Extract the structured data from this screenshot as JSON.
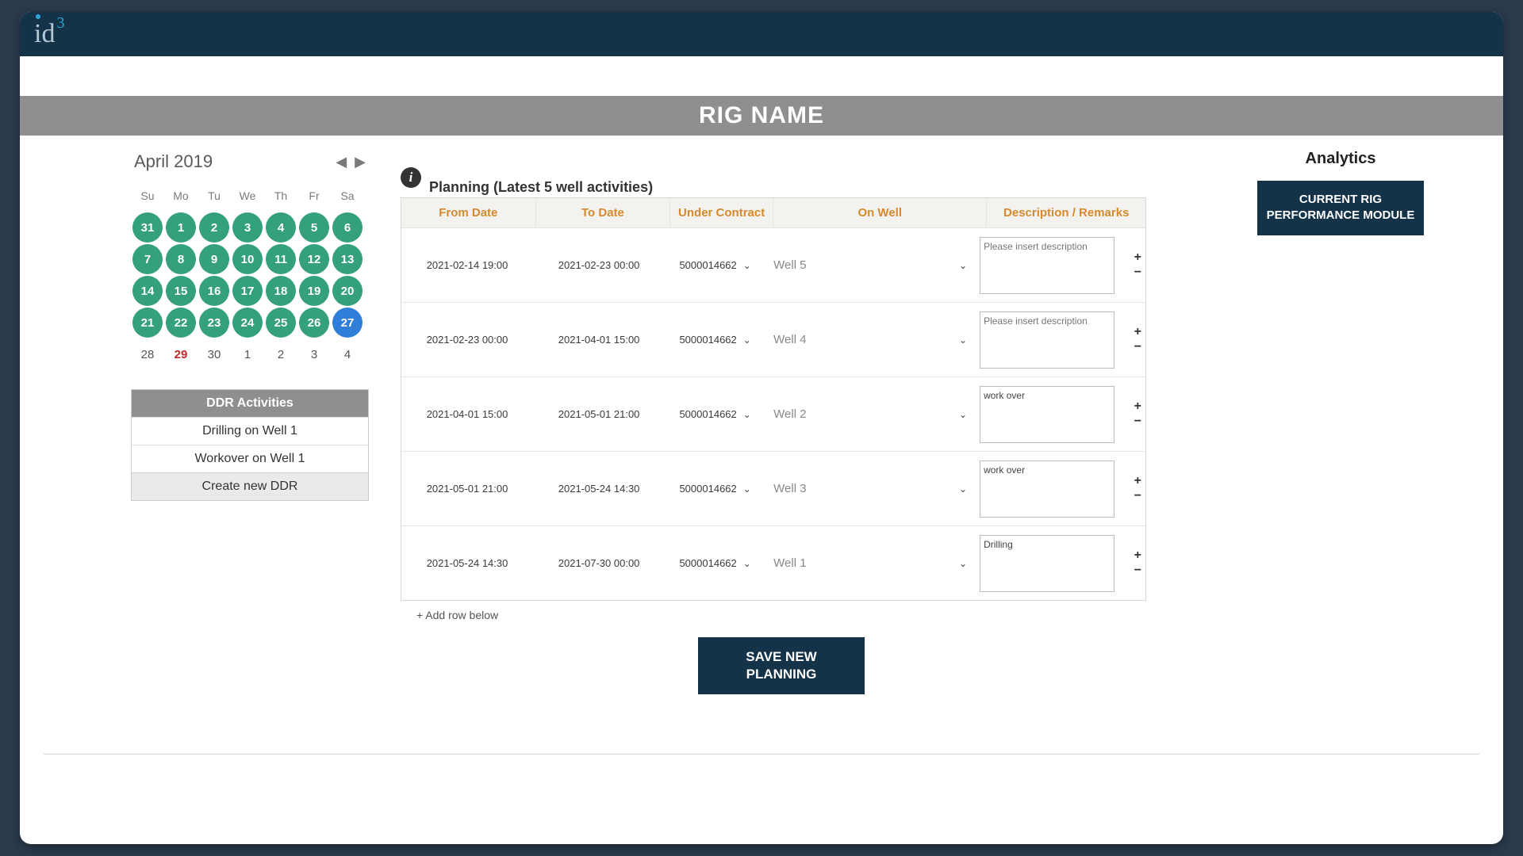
{
  "header": {
    "logo_text": "id",
    "logo_sup": "3"
  },
  "titlebar": "RIG NAME",
  "calendar": {
    "title": "April 2019",
    "weekday_labels": [
      "Su",
      "Mo",
      "Tu",
      "We",
      "Th",
      "Fr",
      "Sa"
    ],
    "rows": [
      [
        {
          "n": "31",
          "style": "green"
        },
        {
          "n": "1",
          "style": "green"
        },
        {
          "n": "2",
          "style": "green"
        },
        {
          "n": "3",
          "style": "green"
        },
        {
          "n": "4",
          "style": "green"
        },
        {
          "n": "5",
          "style": "green"
        },
        {
          "n": "6",
          "style": "green"
        }
      ],
      [
        {
          "n": "7",
          "style": "green"
        },
        {
          "n": "8",
          "style": "green"
        },
        {
          "n": "9",
          "style": "green"
        },
        {
          "n": "10",
          "style": "green"
        },
        {
          "n": "11",
          "style": "green"
        },
        {
          "n": "12",
          "style": "green"
        },
        {
          "n": "13",
          "style": "green"
        }
      ],
      [
        {
          "n": "14",
          "style": "green"
        },
        {
          "n": "15",
          "style": "green"
        },
        {
          "n": "16",
          "style": "green"
        },
        {
          "n": "17",
          "style": "green"
        },
        {
          "n": "18",
          "style": "green"
        },
        {
          "n": "19",
          "style": "green"
        },
        {
          "n": "20",
          "style": "green"
        }
      ],
      [
        {
          "n": "21",
          "style": "green"
        },
        {
          "n": "22",
          "style": "green"
        },
        {
          "n": "23",
          "style": "green"
        },
        {
          "n": "24",
          "style": "green"
        },
        {
          "n": "25",
          "style": "green"
        },
        {
          "n": "26",
          "style": "green"
        },
        {
          "n": "27",
          "style": "blue"
        }
      ],
      [
        {
          "n": "28",
          "style": "plain"
        },
        {
          "n": "29",
          "style": "red"
        },
        {
          "n": "30",
          "style": "plain"
        },
        {
          "n": "1",
          "style": "plain"
        },
        {
          "n": "2",
          "style": "plain"
        },
        {
          "n": "3",
          "style": "plain"
        },
        {
          "n": "4",
          "style": "plain"
        }
      ]
    ]
  },
  "ddr": {
    "header": "DDR Activities",
    "items": [
      "Drilling on Well 1",
      "Workover on Well 1"
    ],
    "create_label": "Create new DDR"
  },
  "planning": {
    "title": "Planning (Latest 5 well activities)",
    "columns": [
      "From Date",
      "To Date",
      "Under Contract",
      "On Well",
      "Description / Remarks"
    ],
    "rows": [
      {
        "from": "2021-02-14 19:00",
        "to": "2021-02-23 00:00",
        "contract": "5000014662",
        "well": "Well 5",
        "desc": "",
        "placeholder": "Please insert description"
      },
      {
        "from": "2021-02-23 00:00",
        "to": "2021-04-01 15:00",
        "contract": "5000014662",
        "well": "Well 4",
        "desc": "",
        "placeholder": "Please insert description"
      },
      {
        "from": "2021-04-01 15:00",
        "to": "2021-05-01 21:00",
        "contract": "5000014662",
        "well": "Well 2",
        "desc": "work over",
        "placeholder": ""
      },
      {
        "from": "2021-05-01 21:00",
        "to": "2021-05-24 14:30",
        "contract": "5000014662",
        "well": "Well 3",
        "desc": "work over",
        "placeholder": ""
      },
      {
        "from": "2021-05-24 14:30",
        "to": "2021-07-30 00:00",
        "contract": "5000014662",
        "well": "Well 1",
        "desc": "Drilling",
        "placeholder": ""
      }
    ],
    "add_row_label": "+ Add row below",
    "save_label": "SAVE NEW PLANNING"
  },
  "analytics": {
    "title": "Analytics",
    "button_label": "CURRENT RIG PERFORMANCE MODULE"
  }
}
